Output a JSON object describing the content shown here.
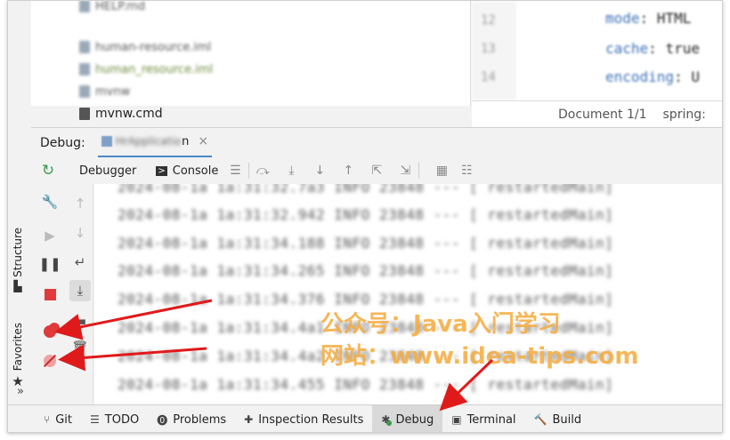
{
  "colors": {
    "accent": "#4a87c7",
    "stop": "#e03a3a",
    "run": "#3a9a4a",
    "watermark": "#f4aa3c",
    "arrow": "#e01a1a"
  },
  "tree": {
    "rows": [
      {
        "label": "HELP.md",
        "icon": "markdown-file-icon",
        "blur": true
      },
      {
        "label": "human-resource.iml",
        "icon": "module-file-icon",
        "blur": true
      },
      {
        "label": "human_resource.iml",
        "icon": "module-file-icon",
        "blur": true
      },
      {
        "label": "mvnw",
        "icon": "script-file-icon",
        "blur": true
      },
      {
        "label": "mvnw.cmd",
        "icon": "cmd-file-icon",
        "blur": false
      }
    ]
  },
  "editor": {
    "lines": [
      "12",
      "13",
      "14"
    ],
    "code": [
      {
        "key": "mode",
        "value": "HTML"
      },
      {
        "key": "cache",
        "value": "true"
      },
      {
        "key": "encoding",
        "value": "U"
      }
    ],
    "breadcrumb_doc": "Document 1/1",
    "breadcrumb_path": "spring:"
  },
  "debug": {
    "label": "Debug:",
    "tab_name_blurred": "HrApplicatio",
    "tab_name_visible": "n",
    "close_glyph": "×",
    "toolbar": {
      "debugger": "Debugger",
      "console": "Console"
    }
  },
  "console": {
    "lines": [
      "2024-08-1a 1a:31:32.7a3  INFO 23848 --- [  restartedMain]",
      "2024-08-1a 1a:31:32.942  INFO 23848 --- [  restartedMain]",
      "2024-08-1a 1a:31:34.188  INFO 23848 --- [  restartedMain]",
      "2024-08-1a 1a:31:34.265  INFO 23848 --- [  restartedMain]",
      "2024-08-1a 1a:31:34.376  INFO 23848 --- [  restartedMain]",
      "2024-08-1a 1a:31:34.4a1  INFO 23848 --- [  restartedMain]",
      "2024-08-1a 1a:31:34.4a2  INFO 23848 --- [  restartedMain]",
      "2024-08-1a 1a:31:34.455  INFO 23848 --- [  restartedMain]"
    ]
  },
  "watermark": {
    "line1": "公众号：Java入门学习",
    "line2": "网站：www.idea-tips.com"
  },
  "side_tabs": {
    "structure": "Structure",
    "favorites": "Favorites",
    "more": "»"
  },
  "bottom": {
    "items": [
      {
        "label": "Git",
        "icon": "git-branch-icon"
      },
      {
        "label": "TODO",
        "icon": "todo-list-icon"
      },
      {
        "label": "Problems",
        "icon": "problems-icon"
      },
      {
        "label": "Inspection Results",
        "icon": "inspection-icon"
      },
      {
        "label": "Debug",
        "icon": "debug-bug-icon",
        "active": true
      },
      {
        "label": "Terminal",
        "icon": "terminal-icon"
      },
      {
        "label": "Build",
        "icon": "build-hammer-icon"
      }
    ]
  }
}
